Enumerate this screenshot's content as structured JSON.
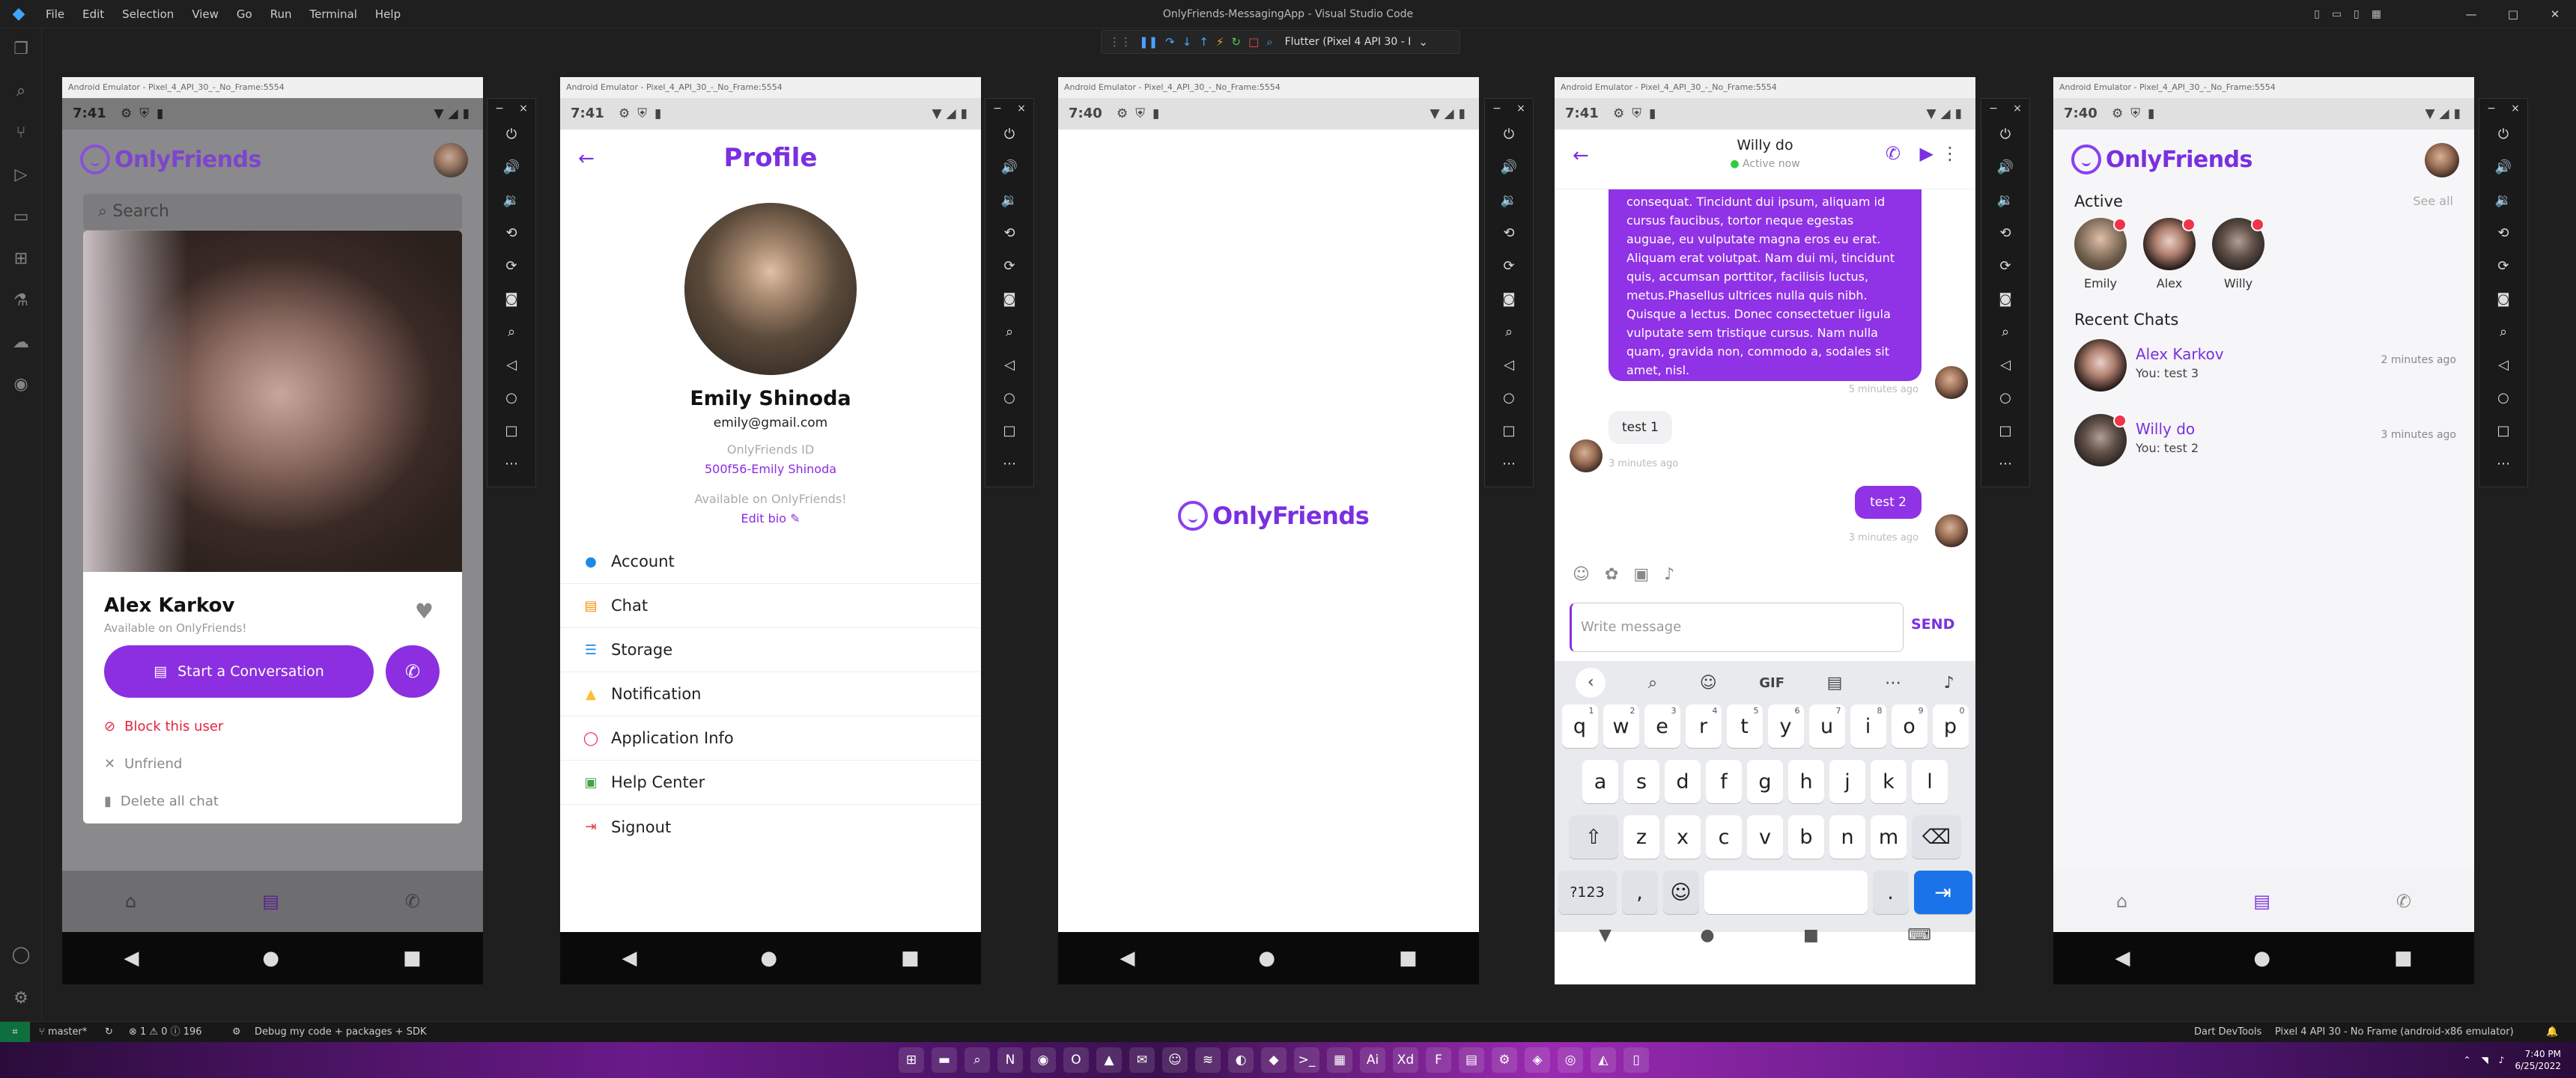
{
  "app": {
    "title": "OnlyFriends-MessagingApp - Visual Studio Code",
    "menu": [
      "File",
      "Edit",
      "Selection",
      "View",
      "Go",
      "Run",
      "Terminal",
      "Help"
    ],
    "device_selector": "Flutter (Pixel 4 API 30 - I",
    "logo_icon": "vscode-icon"
  },
  "status": {
    "branch": "master*",
    "problems": "⊗ 1 ⚠ 0 ⓘ 196",
    "debug_mode": "Debug my code + packages + SDK",
    "devtools": "Dart DevTools",
    "device": "Pixel 4 API 30 - No Frame (android-x86 emulator)"
  },
  "taskbar": {
    "time": "7:40 PM",
    "date": "6/25/2022"
  },
  "emulator": {
    "window_title": "Android Emulator - Pixel_4_API_30_-_No_Frame:5554"
  },
  "brand": {
    "name": "OnlyFriends",
    "accent": "#8b2fe0",
    "danger": "#e5233b"
  },
  "screen1": {
    "time": "7:41",
    "search_placeholder": "Search",
    "profile_name": "Alex Karkov",
    "profile_status": "Available on OnlyFriends!",
    "start_conversation": "Start a Conversation",
    "block": "Block this user",
    "unfriend": "Unfriend",
    "delete_chat": "Delete all chat"
  },
  "screen2": {
    "time": "7:41",
    "title": "Profile",
    "name": "Emily Shinoda",
    "email": "emily@gmail.com",
    "id_label": "OnlyFriends ID",
    "id_value": "500f56-Emily Shinoda",
    "availability": "Available on OnlyFriends!",
    "edit_bio": "Edit bio",
    "menu": [
      {
        "label": "Account",
        "icon": "person-icon",
        "color": "#1e88e5"
      },
      {
        "label": "Chat",
        "icon": "chat-icon",
        "color": "#fb8c00"
      },
      {
        "label": "Storage",
        "icon": "storage-icon",
        "color": "#1e88e5"
      },
      {
        "label": "Notification",
        "icon": "bell-icon",
        "color": "#fbc02d"
      },
      {
        "label": "Application Info",
        "icon": "info-ring-icon",
        "color": "#e91e63"
      },
      {
        "label": "Help Center",
        "icon": "help-icon",
        "color": "#43a047"
      },
      {
        "label": "Signout",
        "icon": "signout-icon",
        "color": "#e53935"
      }
    ]
  },
  "screen3": {
    "time": "7:40",
    "splash_logo": "OnlyFriends"
  },
  "screen4": {
    "time": "7:41",
    "contact_name": "Willy do",
    "contact_status": "Active now",
    "long_message": "consequat. Tincidunt dui ipsum, aliquam id cursus faucibus, tortor neque egestas auguae, eu vulputate magna eros eu erat. Aliquam erat volutpat. Nam dui mi, tincidunt quis, accumsan porttitor, facilisis luctus, metus.Phasellus ultrices nulla quis nibh. Quisque a lectus. Donec consectetuer ligula vulputate sem tristique cursus. Nam nulla quam, gravida non, commodo a, sodales sit amet, nisl.",
    "long_time": "5 minutes ago",
    "msg_in": "test 1",
    "msg_in_time": "3 minutes ago",
    "msg_out": "test 2",
    "msg_out_time": "3 minutes ago",
    "input_placeholder": "Write message",
    "send": "SEND",
    "keyboard": {
      "row1": [
        "q",
        "w",
        "e",
        "r",
        "t",
        "y",
        "u",
        "i",
        "o",
        "p"
      ],
      "row1_hints": [
        "1",
        "2",
        "3",
        "4",
        "5",
        "6",
        "7",
        "8",
        "9",
        "0"
      ],
      "row2": [
        "a",
        "s",
        "d",
        "f",
        "g",
        "h",
        "j",
        "k",
        "l"
      ],
      "row3": [
        "z",
        "x",
        "c",
        "v",
        "b",
        "n",
        "m"
      ],
      "sym": "?123",
      "comma": ",",
      "period": ".",
      "gif": "GIF"
    }
  },
  "screen5": {
    "time": "7:40",
    "active_label": "Active",
    "see_all": "See all",
    "active_users": [
      "Emily",
      "Alex",
      "Willy"
    ],
    "recent_label": "Recent Chats",
    "chats": [
      {
        "name": "Alex Karkov",
        "preview": "You: test 3",
        "time": "2 minutes ago"
      },
      {
        "name": "Willy do",
        "preview": "You: test 2",
        "time": "3 minutes ago"
      }
    ]
  }
}
